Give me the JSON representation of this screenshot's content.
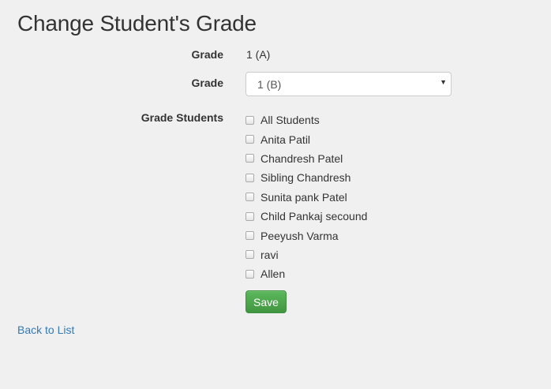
{
  "page": {
    "title": "Change Student's Grade"
  },
  "form": {
    "current_grade_label": "Grade",
    "current_grade_value": "1 (A)",
    "new_grade_label": "Grade",
    "new_grade_selected": "1 (B)",
    "students_label": "Grade Students",
    "students": [
      {
        "label": "All Students",
        "checked": false
      },
      {
        "label": "Anita Patil",
        "checked": false
      },
      {
        "label": "Chandresh Patel",
        "checked": false
      },
      {
        "label": "Sibling Chandresh",
        "checked": false
      },
      {
        "label": "Sunita pank Patel",
        "checked": false
      },
      {
        "label": "Child Pankaj secound",
        "checked": false
      },
      {
        "label": "Peeyush Varma",
        "checked": false
      },
      {
        "label": "ravi",
        "checked": false
      },
      {
        "label": "Allen",
        "checked": false
      }
    ],
    "save_label": "Save"
  },
  "footer": {
    "back_link_label": "Back to List"
  },
  "colors": {
    "background": "#f0f0f0",
    "save_button": "#4cae4c",
    "link": "#337ab7"
  }
}
